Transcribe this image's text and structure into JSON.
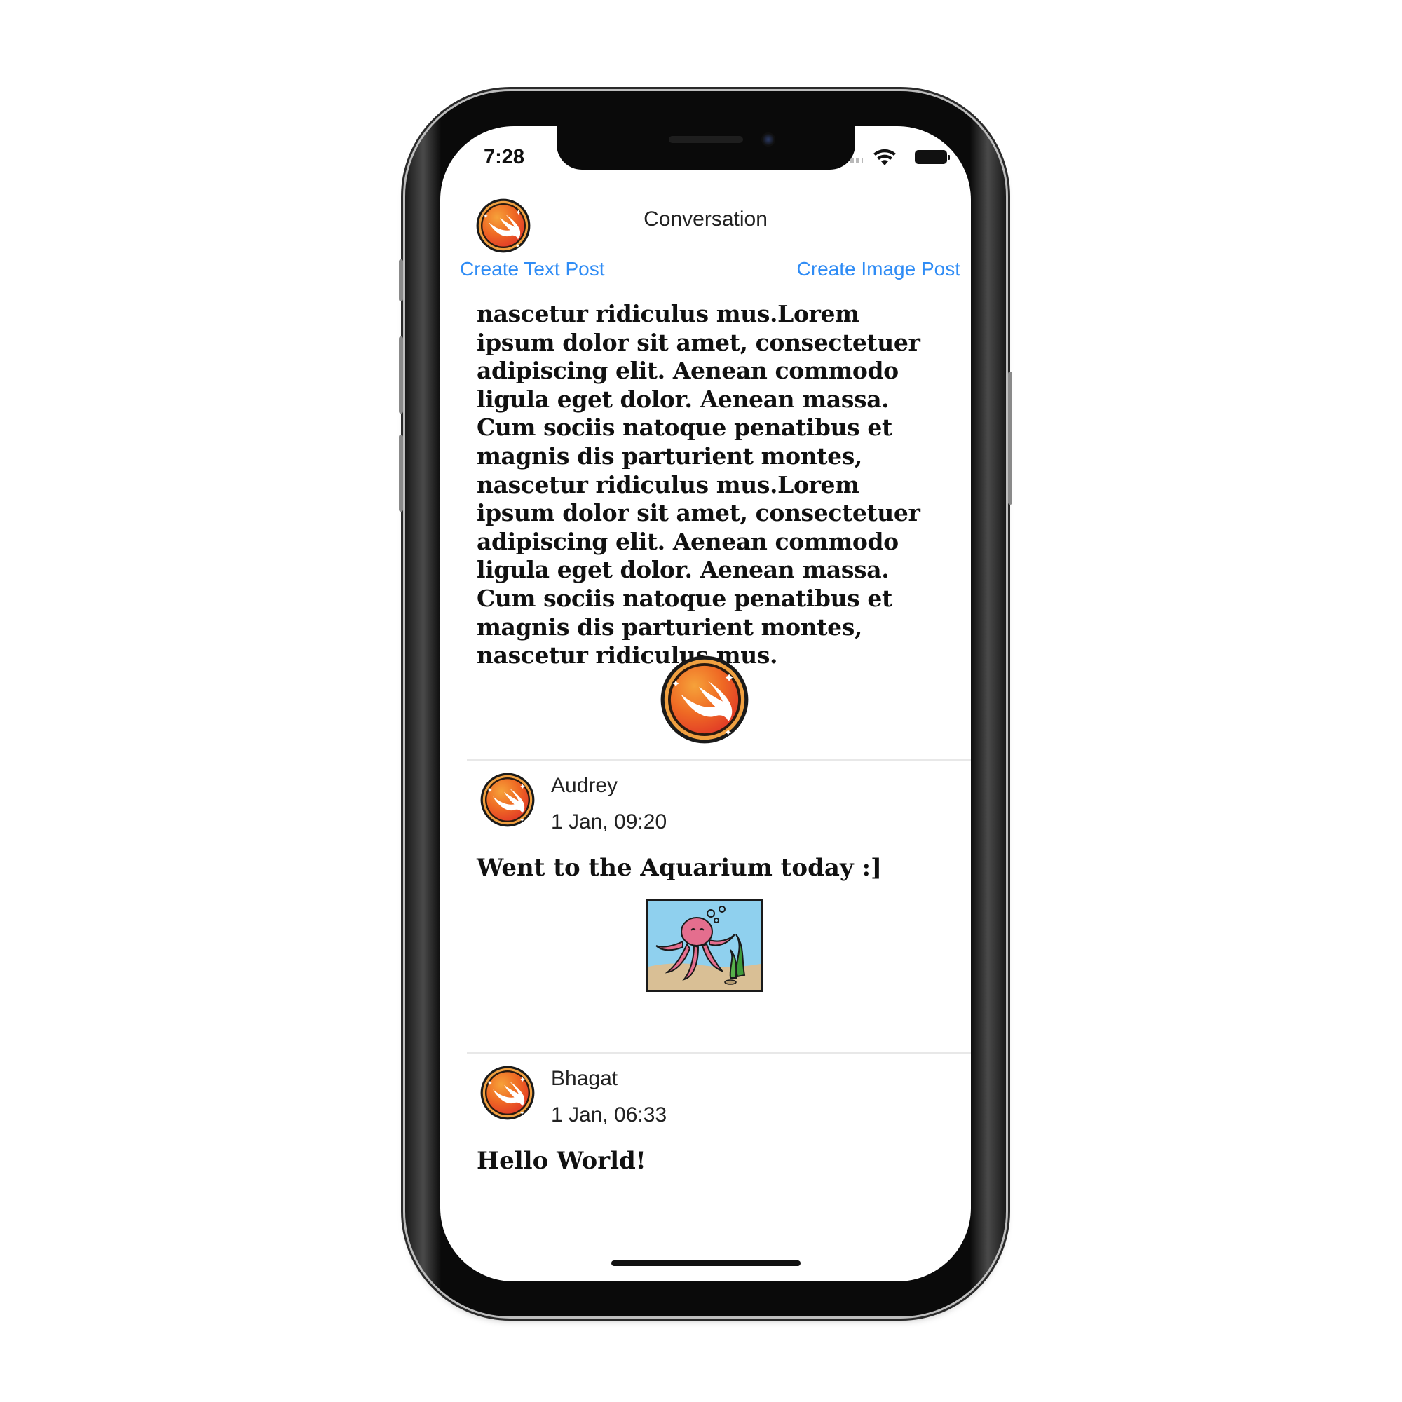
{
  "status_bar": {
    "time": "7:28"
  },
  "nav": {
    "title": "Conversation",
    "create_text_post": "Create Text Post",
    "create_image_post": "Create Image Post"
  },
  "feed": {
    "long_post_text": "nascetur ridiculus mus.Lorem ipsum dolor sit amet, consectetuer adipiscing elit. Aenean commodo ligula eget dolor. Aenean massa. Cum sociis natoque penatibus et magnis dis parturient montes, nascetur ridiculus mus.Lorem ipsum dolor sit amet, consectetuer adipiscing elit. Aenean commodo ligula eget dolor. Aenean massa. Cum sociis natoque penatibus et magnis dis parturient montes, nascetur ridiculus mus.",
    "posts": [
      {
        "author": "Audrey",
        "date": "1 Jan, 09:20",
        "text": "Went to the Aquarium today :]"
      },
      {
        "author": "Bhagat",
        "date": "1 Jan, 06:33",
        "text": "Hello World!"
      }
    ]
  },
  "colors": {
    "link": "#2f8cf5",
    "swift_orange": "#f08a1c",
    "swift_red": "#e8462a"
  },
  "icons": [
    "swift-logo-icon",
    "wifi-icon",
    "battery-icon",
    "signal-icon",
    "octopus-aquarium-image"
  ]
}
